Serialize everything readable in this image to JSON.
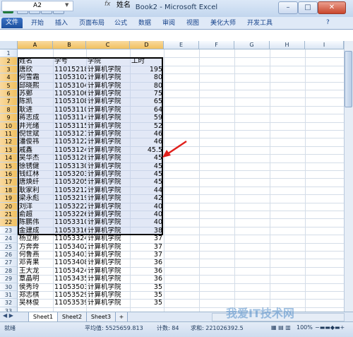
{
  "window": {
    "title": "Book2 - Microsoft Excel",
    "app_icon": "X",
    "minimize": "–",
    "maximize": "□",
    "close": "✕"
  },
  "ribbon": {
    "file_label": "文件",
    "tabs": [
      "开始",
      "插入",
      "页面布局",
      "公式",
      "数据",
      "审阅",
      "视图",
      "美化大师",
      "开发工具"
    ]
  },
  "formula_bar": {
    "name_box": "A2",
    "fx": "fx",
    "content": "姓名"
  },
  "columns": [
    "A",
    "B",
    "C",
    "D",
    "E",
    "F",
    "G",
    "H",
    "I"
  ],
  "row_numbers": [
    "1",
    "2",
    "3",
    "4",
    "5",
    "6",
    "7",
    "8",
    "9",
    "10",
    "11",
    "12",
    "13",
    "14",
    "15",
    "16",
    "17",
    "18",
    "19",
    "20",
    "21",
    "22",
    "23",
    "24",
    "25",
    "26",
    "27",
    "28",
    "29",
    "30",
    "31",
    "32",
    "33"
  ],
  "header_row": {
    "name": "姓名",
    "id": "学号",
    "college": "学院",
    "hours": "工时"
  },
  "rows": [
    {
      "name": "唐欣",
      "id": "11015218",
      "college": "计算机学院",
      "hours": "195"
    },
    {
      "name": "何雪霜",
      "id": "11053102",
      "college": "计算机学院",
      "hours": "80"
    },
    {
      "name": "邱晓熙",
      "id": "11053104",
      "college": "计算机学院",
      "hours": "80"
    },
    {
      "name": "苏鄄",
      "id": "11053106",
      "college": "计算机学院",
      "hours": "75"
    },
    {
      "name": "陈凯",
      "id": "11053108",
      "college": "计算机学院",
      "hours": "65"
    },
    {
      "name": "耿进",
      "id": "11053110",
      "college": "计算机学院",
      "hours": "64"
    },
    {
      "name": "蒋志成",
      "id": "11053114",
      "college": "计算机学院",
      "hours": "59"
    },
    {
      "name": "井光绪",
      "id": "11053115",
      "college": "计算机学院",
      "hours": "52"
    },
    {
      "name": "倪世斌",
      "id": "11053121",
      "college": "计算机学院",
      "hours": "46"
    },
    {
      "name": "潘俊祎",
      "id": "11053122",
      "college": "计算机学院",
      "hours": "46"
    },
    {
      "name": "戚鑫",
      "id": "11053124",
      "college": "计算机学院",
      "hours": "45.5"
    },
    {
      "name": "吴华杰",
      "id": "11053128",
      "college": "计算机学院",
      "hours": "45"
    },
    {
      "name": "徐锈健",
      "id": "11053130",
      "college": "计算机学院",
      "hours": "45"
    },
    {
      "name": "钱红林",
      "id": "11053203",
      "college": "计算机学院",
      "hours": "45"
    },
    {
      "name": "唐焕纤",
      "id": "11053205",
      "college": "计算机学院",
      "hours": "45"
    },
    {
      "name": "耿家利",
      "id": "11053212",
      "college": "计算机学院",
      "hours": "44"
    },
    {
      "name": "梁永彪",
      "id": "11053219",
      "college": "计算机学院",
      "hours": "42"
    },
    {
      "name": "刘洋",
      "id": "11053222",
      "college": "计算机学院",
      "hours": "40"
    },
    {
      "name": "俞超",
      "id": "11053226",
      "college": "计算机学院",
      "hours": "40"
    },
    {
      "name": "陈鹏伟",
      "id": "11053310",
      "college": "计算机学院",
      "hours": "40"
    },
    {
      "name": "金建成",
      "id": "11053316",
      "college": "计算机学院",
      "hours": "38"
    },
    {
      "name": "杨立彬",
      "id": "11053324",
      "college": "计算机学院",
      "hours": "37"
    },
    {
      "name": "方奔奔",
      "id": "11053402",
      "college": "计算机学院",
      "hours": "37"
    },
    {
      "name": "何鲁燕",
      "id": "11053403",
      "college": "计算机学院",
      "hours": "37"
    },
    {
      "name": "邓青果",
      "id": "11053408",
      "college": "计算机学院",
      "hours": "36"
    },
    {
      "name": "王大龙",
      "id": "11053424",
      "college": "计算机学院",
      "hours": "36"
    },
    {
      "name": "覃晶明",
      "id": "11053435",
      "college": "计算机学院",
      "hours": "36"
    },
    {
      "name": "侯秀玲",
      "id": "11053503",
      "college": "计算机学院",
      "hours": "35"
    },
    {
      "name": "郑志棋",
      "id": "11053529",
      "college": "计算机学院",
      "hours": "35"
    },
    {
      "name": "吴林俊",
      "id": "11053539",
      "college": "计算机学院",
      "hours": "35"
    }
  ],
  "sheet_tabs": [
    "Sheet1",
    "Sheet2",
    "Sheet3"
  ],
  "status": {
    "ready": "就绪",
    "average": "平均值: 5525659.813",
    "count": "计数: 84",
    "sum": "求和: 221026392.5",
    "zoom": "100%"
  },
  "watermark": "我爱IT技术网",
  "colors": {
    "selection_fill": "#d0dcf0",
    "arrow": "#e0201c",
    "accent": "#1b4f9e"
  }
}
